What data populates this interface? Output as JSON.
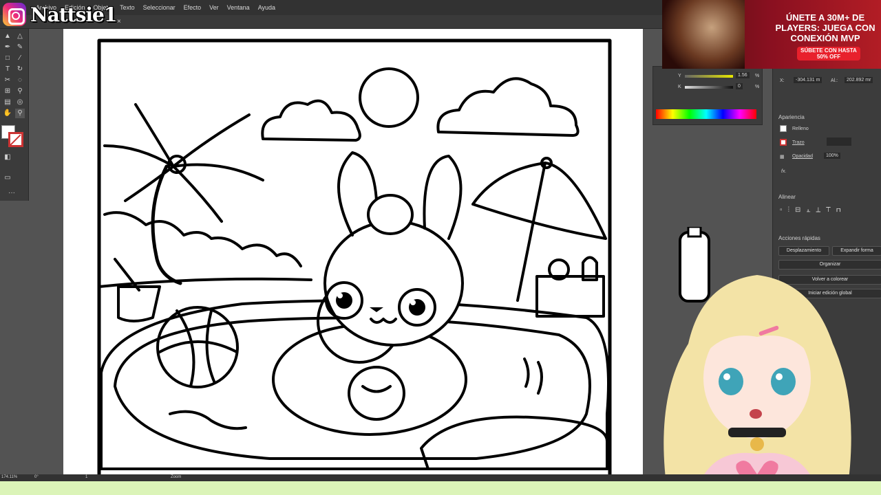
{
  "brand": {
    "name": "Nattsie1",
    "icon": "instagram-icon"
  },
  "menu": [
    "Archivo",
    "Edición",
    "Objeto",
    "Texto",
    "Seleccionar",
    "Efecto",
    "Ver",
    "Ventana",
    "Ayuda"
  ],
  "doc_tab": {
    "close": "×"
  },
  "ad": {
    "headline": "ÚNETE A 30M+ DE PLAYERS: JUEGA CON CONEXIÓN MVP",
    "cta": "SÚBETE CON HASTA 50% OFF"
  },
  "color_panel": {
    "y_value": "1.56",
    "k_value": "0",
    "percent": "%"
  },
  "transform": {
    "x_label": "X:",
    "x_value": "-304.131 m",
    "y_label": "Al.:",
    "y_value": "202.892 mr"
  },
  "appearance": {
    "title": "Apariencia",
    "fill_label": "Relleno",
    "stroke_label": "Trazo",
    "opacity_label": "Opacidad",
    "opacity_value": "100%",
    "fx": "fx."
  },
  "align": {
    "title": "Alinear"
  },
  "quick_actions": {
    "title": "Acciones rápidas",
    "buttons": [
      "Desplazamiento",
      "Expandir forma",
      "Organizar",
      "Volver a colorear",
      "Iniciar edición global"
    ]
  },
  "statusbar": {
    "zoom": "174.11%",
    "rotation": "0°",
    "artboard": "1",
    "tool": "Zoom"
  }
}
